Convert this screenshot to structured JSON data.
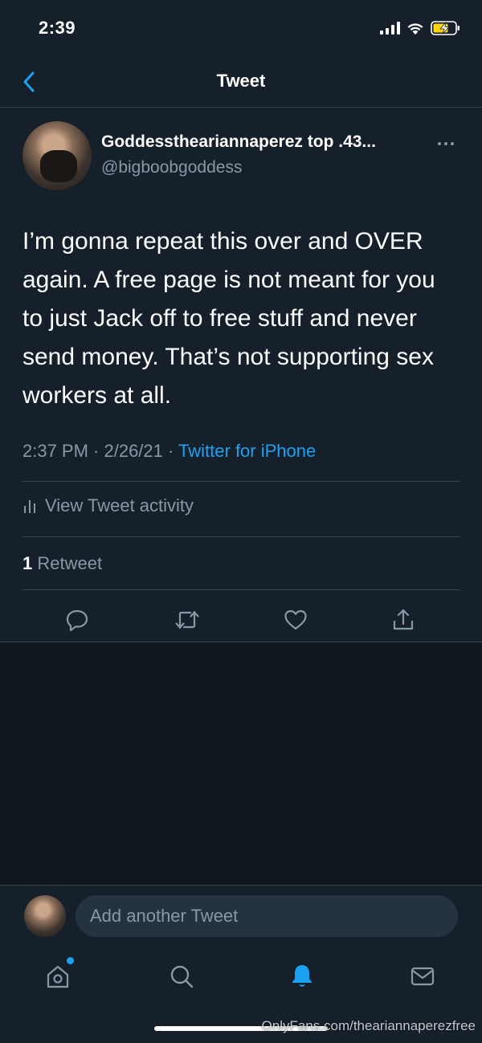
{
  "status_bar": {
    "time": "2:39"
  },
  "nav": {
    "title": "Tweet"
  },
  "tweet": {
    "display_name": "Goddessthearian­naperez top .43...",
    "handle": "@bigboobgoddess",
    "text": "I’m gonna repeat this over and OVER again. A free page is not meant for you to just Jack off to free stuff and never send money. That’s not supporting sex workers at all.",
    "timestamp": "2:37 PM · 2/26/21 · ",
    "source": "Twitter for iPhone",
    "activity_label": "View Tweet activity",
    "retweet_count": "1",
    "retweet_label": " Retweet"
  },
  "compose": {
    "placeholder": "Add another Tweet"
  },
  "tabs": [
    "home-icon",
    "search-icon",
    "bell-icon",
    "mail-icon"
  ],
  "watermark": "OnlyFans.com/theariannaperezfree",
  "colors": {
    "background": "#15202b",
    "accent": "#1da1f2",
    "muted": "#8899a6",
    "divider": "#38444d"
  }
}
